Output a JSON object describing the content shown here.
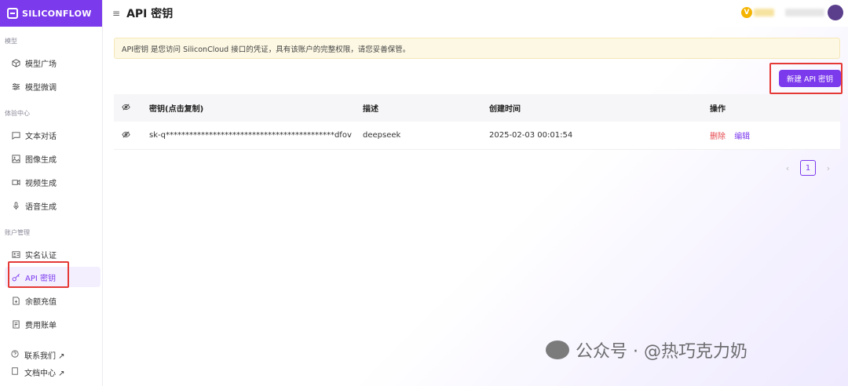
{
  "brand": {
    "name": "SILICONFLOW"
  },
  "header": {
    "title": "API 密钥"
  },
  "sidebar": {
    "sections": [
      {
        "title": "模型",
        "items": [
          {
            "label": "模型广场",
            "icon": "cube-icon"
          },
          {
            "label": "模型微调",
            "icon": "sliders-icon"
          }
        ]
      },
      {
        "title": "体验中心",
        "items": [
          {
            "label": "文本对话",
            "icon": "chat-icon"
          },
          {
            "label": "图像生成",
            "icon": "image-icon"
          },
          {
            "label": "视频生成",
            "icon": "video-icon"
          },
          {
            "label": "语音生成",
            "icon": "mic-icon"
          }
        ]
      },
      {
        "title": "账户管理",
        "items": [
          {
            "label": "实名认证",
            "icon": "id-card-icon"
          },
          {
            "label": "API 密钥",
            "icon": "key-icon",
            "active": true
          },
          {
            "label": "余额充值",
            "icon": "wallet-icon"
          },
          {
            "label": "费用账单",
            "icon": "bill-icon"
          }
        ]
      }
    ],
    "footer": [
      {
        "label": "联系我们 ↗",
        "icon": "help-icon"
      },
      {
        "label": "文档中心 ↗",
        "icon": "doc-icon"
      }
    ]
  },
  "notice": "API密钥 是您访问 SiliconCloud 接口的凭证，具有该账户的完整权限，请您妥善保管。",
  "new_button": "新建 API 密钥",
  "table": {
    "columns": [
      "密钥(点击复制)",
      "描述",
      "创建时间",
      "操作"
    ],
    "rows": [
      {
        "key": "sk-q*******************************************dfov",
        "description": "deepseek",
        "created": "2025-02-03 00:01:54",
        "actions": [
          "删除",
          "编辑"
        ]
      }
    ]
  },
  "pagination": {
    "current": "1",
    "prev": "‹",
    "next": "›"
  },
  "watermark": "公众号 · @热巧克力奶",
  "colors": {
    "accent": "#7c3aed",
    "danger": "#e5484d",
    "highlight_box": "#e53935"
  }
}
